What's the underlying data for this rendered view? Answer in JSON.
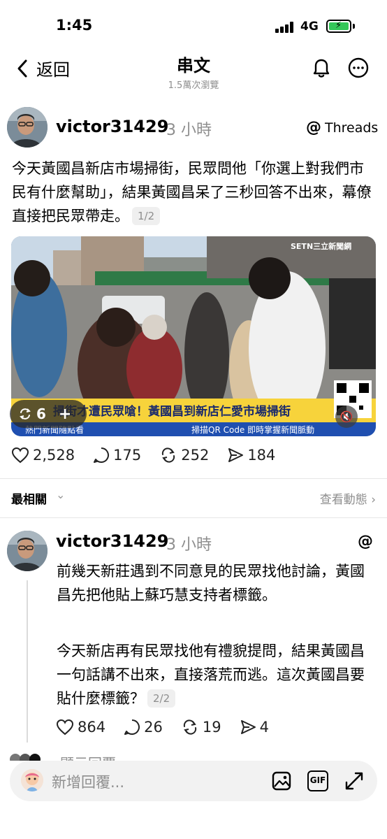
{
  "status_bar": {
    "time": "1:45",
    "network": "4G"
  },
  "header": {
    "back_label": "返回",
    "title": "串文",
    "views": "1.5萬次瀏覽"
  },
  "post": {
    "username": "victor31429",
    "time_ago": "3 小時",
    "source": "Threads",
    "text": "今天黃國昌新店市場掃街，民眾問他「你選上對我們市民有什麼幫助」，結果黃國昌呆了三秒回答不出來，幕僚直接把民眾帶走。",
    "page": "1/2",
    "media": {
      "watermark": "SETN三立新聞網",
      "headline": "掃街才遭民眾嗆！黃國昌到新店仁愛市場掃街",
      "ticker_left": "熱門新聞隨點看",
      "ticker_right": "掃描QR Code 即時掌握新聞脈動",
      "count": "6"
    },
    "likes": "2,528",
    "comments": "175",
    "reposts": "252",
    "shares": "184"
  },
  "sort": {
    "label": "最相關",
    "activity": "查看動態"
  },
  "reply": {
    "username": "victor31429",
    "time_ago": "3 小時",
    "paragraph1": "前幾天新莊遇到不同意見的民眾找他討論，黃國昌先把他貼上蘇巧慧支持者標籤。",
    "paragraph2": "今天新店再有民眾找他有禮貌提問，結果黃國昌一句話講不出來，直接落荒而逃。這次黃國昌要貼什麼標籤？",
    "page": "2/2",
    "likes": "864",
    "comments": "26",
    "reposts": "19",
    "shares": "4"
  },
  "peek_text": "顯示回覆",
  "composer": {
    "placeholder": "新增回覆...",
    "gif_label": "GIF"
  },
  "colors": {
    "battery": "#34c759",
    "muted": "#8e8e8e"
  }
}
